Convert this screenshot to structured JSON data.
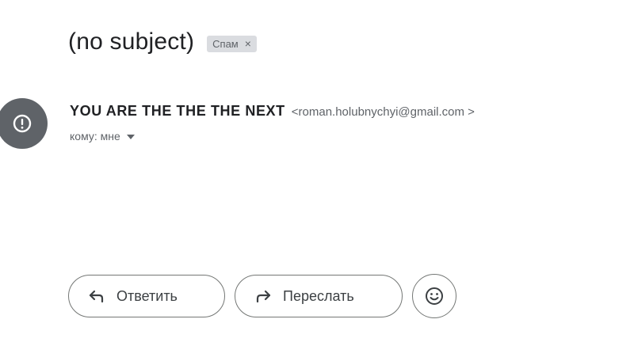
{
  "email": {
    "subject": "(no subject)",
    "label": {
      "text": "Спам",
      "close_symbol": "×"
    },
    "sender": {
      "name": "YOU ARE THE THE THE NEXT",
      "email": "<roman.holubnychyi@gmail.com >",
      "avatar_icon": "warning-exclamation-icon"
    },
    "recipient": {
      "text": "кому: мне"
    }
  },
  "actions": {
    "reply_label": "Ответить",
    "forward_label": "Переслать",
    "emoji_icon": "smiley-icon"
  },
  "colors": {
    "avatar_bg": "#5f6368",
    "chip_bg": "#dadce0",
    "text_primary": "#202124",
    "text_secondary": "#5f6368"
  }
}
